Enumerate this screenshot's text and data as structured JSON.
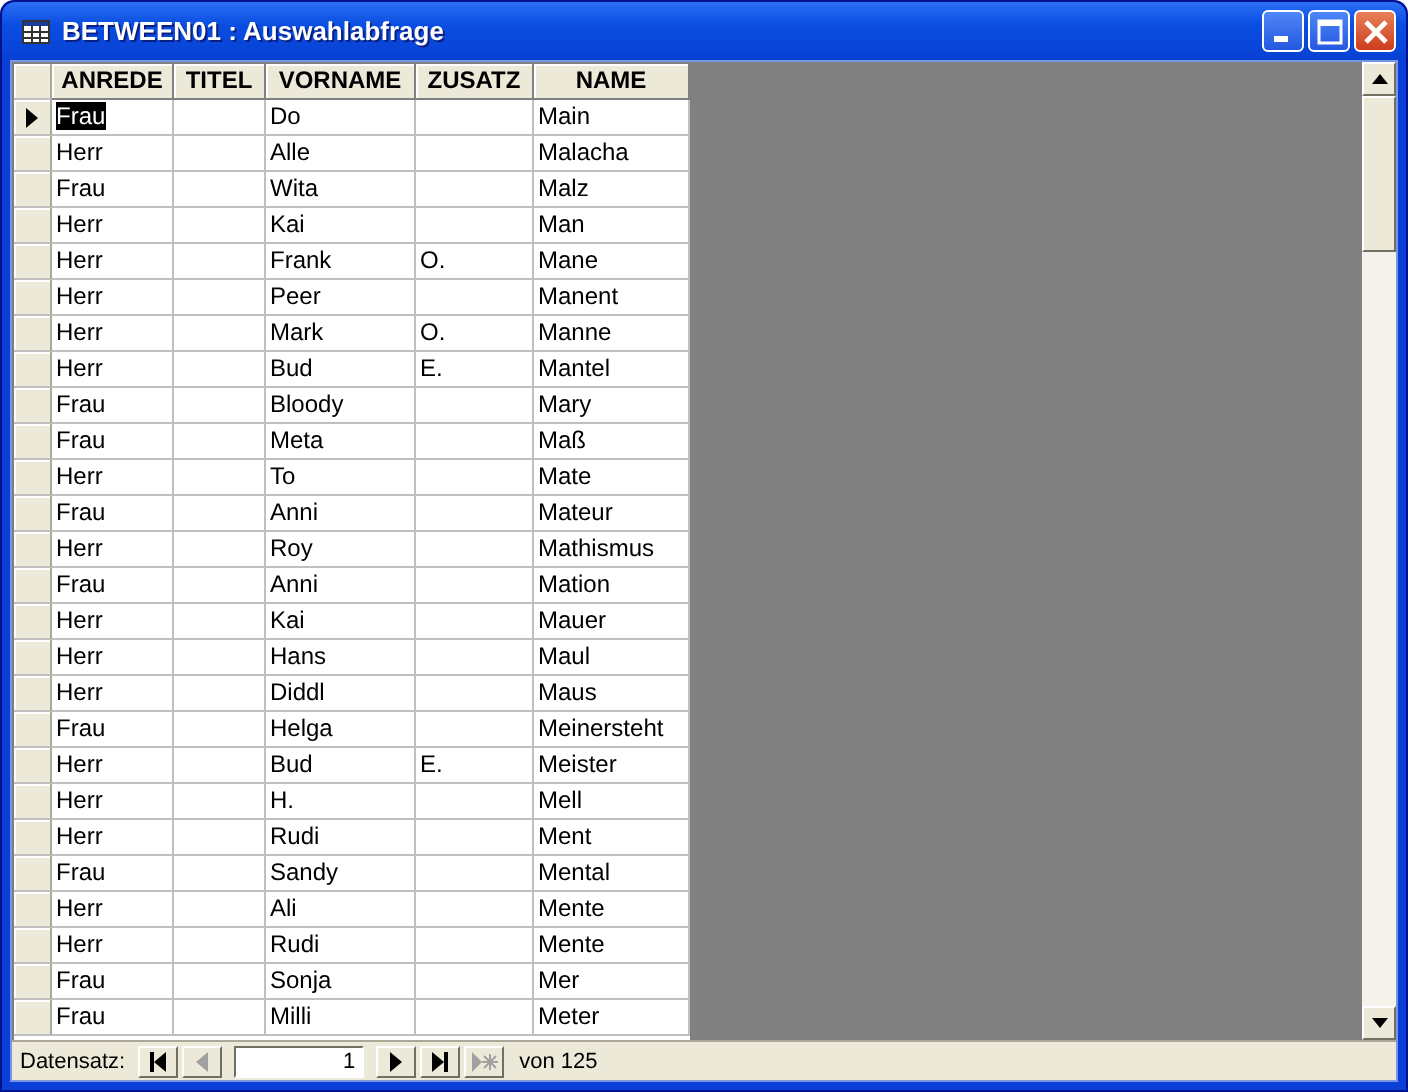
{
  "window": {
    "title": "BETWEEN01 : Auswahlabfrage"
  },
  "table": {
    "columns": [
      "ANREDE",
      "TITEL",
      "VORNAME",
      "ZUSATZ",
      "NAME"
    ],
    "rows": [
      {
        "selected": true,
        "cells": [
          "Frau",
          "",
          "Do",
          "",
          "Main"
        ]
      },
      {
        "selected": false,
        "cells": [
          "Herr",
          "",
          "Alle",
          "",
          "Malacha"
        ]
      },
      {
        "selected": false,
        "cells": [
          "Frau",
          "",
          "Wita",
          "",
          "Malz"
        ]
      },
      {
        "selected": false,
        "cells": [
          "Herr",
          "",
          "Kai",
          "",
          "Man"
        ]
      },
      {
        "selected": false,
        "cells": [
          "Herr",
          "",
          "Frank",
          "O.",
          "Mane"
        ]
      },
      {
        "selected": false,
        "cells": [
          "Herr",
          "",
          "Peer",
          "",
          "Manent"
        ]
      },
      {
        "selected": false,
        "cells": [
          "Herr",
          "",
          "Mark",
          "O.",
          "Manne"
        ]
      },
      {
        "selected": false,
        "cells": [
          "Herr",
          "",
          "Bud",
          "E.",
          "Mantel"
        ]
      },
      {
        "selected": false,
        "cells": [
          "Frau",
          "",
          "Bloody",
          "",
          "Mary"
        ]
      },
      {
        "selected": false,
        "cells": [
          "Frau",
          "",
          "Meta",
          "",
          "Maß"
        ]
      },
      {
        "selected": false,
        "cells": [
          "Herr",
          "",
          "To",
          "",
          "Mate"
        ]
      },
      {
        "selected": false,
        "cells": [
          "Frau",
          "",
          "Anni",
          "",
          "Mateur"
        ]
      },
      {
        "selected": false,
        "cells": [
          "Herr",
          "",
          "Roy",
          "",
          "Mathismus"
        ]
      },
      {
        "selected": false,
        "cells": [
          "Frau",
          "",
          "Anni",
          "",
          "Mation"
        ]
      },
      {
        "selected": false,
        "cells": [
          "Herr",
          "",
          "Kai",
          "",
          "Mauer"
        ]
      },
      {
        "selected": false,
        "cells": [
          "Herr",
          "",
          "Hans",
          "",
          "Maul"
        ]
      },
      {
        "selected": false,
        "cells": [
          "Herr",
          "",
          "Diddl",
          "",
          "Maus"
        ]
      },
      {
        "selected": false,
        "cells": [
          "Frau",
          "",
          "Helga",
          "",
          "Meinersteht"
        ]
      },
      {
        "selected": false,
        "cells": [
          "Herr",
          "",
          "Bud",
          "E.",
          "Meister"
        ]
      },
      {
        "selected": false,
        "cells": [
          "Herr",
          "",
          "H.",
          "",
          "Mell"
        ]
      },
      {
        "selected": false,
        "cells": [
          "Herr",
          "",
          "Rudi",
          "",
          "Ment"
        ]
      },
      {
        "selected": false,
        "cells": [
          "Frau",
          "",
          "Sandy",
          "",
          "Mental"
        ]
      },
      {
        "selected": false,
        "cells": [
          "Herr",
          "",
          "Ali",
          "",
          "Mente"
        ]
      },
      {
        "selected": false,
        "cells": [
          "Herr",
          "",
          "Rudi",
          "",
          "Mente"
        ]
      },
      {
        "selected": false,
        "cells": [
          "Frau",
          "",
          "Sonja",
          "",
          "Mer"
        ]
      },
      {
        "selected": false,
        "cells": [
          "Frau",
          "",
          "Milli",
          "",
          "Meter"
        ]
      }
    ]
  },
  "navigator": {
    "label": "Datensatz:",
    "record": "1",
    "total": "von  125",
    "buttons": [
      {
        "kind": "first",
        "disabled": false
      },
      {
        "kind": "prev",
        "disabled": true
      },
      {
        "kind": "field"
      },
      {
        "kind": "next",
        "disabled": false
      },
      {
        "kind": "last",
        "disabled": false
      },
      {
        "kind": "new",
        "disabled": true
      }
    ]
  }
}
